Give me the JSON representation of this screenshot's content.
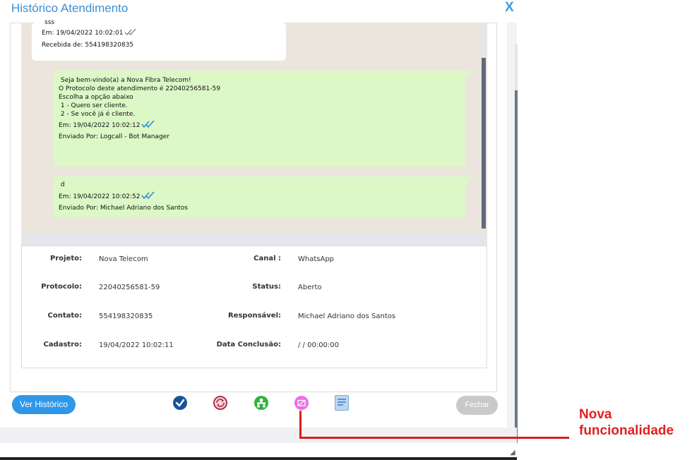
{
  "window": {
    "title": "Histórico Atendimento",
    "close_label": "X"
  },
  "messages": [
    {
      "text_lines": [
        "sss"
      ],
      "meta": "Em: 19/04/2022 10:02:01",
      "by": "Recebida de: 554198320835"
    },
    {
      "text_lines": [
        " Seja bem-vindo(a) a Nova Fibra Telecom!",
        "O Protocolo deste atendimento é 22040256581-59",
        "",
        "Escolha a opção abaixo",
        "",
        " 1 - Quero ser cliente.",
        " 2 - Se você já é cliente."
      ],
      "meta": "Em: 19/04/2022 10:02:12",
      "by": "Enviado Por: Logcall - Bot Manager"
    },
    {
      "text_lines": [
        " d"
      ],
      "meta": "Em: 19/04/2022 10:02:52",
      "by": "Enviado Por: Michael Adriano dos Santos"
    }
  ],
  "info": {
    "projeto_label": "Projeto:",
    "projeto": "Nova Telecom",
    "canal_label": "Canal :",
    "canal": "WhatsApp",
    "protocolo_label": "Protocolo:",
    "protocolo": "22040256581-59",
    "status_label": "Status:",
    "status": "Aberto",
    "contato_label": "Contato:",
    "contato": "554198320835",
    "responsavel_label": "Responsável:",
    "responsavel": "Michael Adriano dos Santos",
    "cadastro_label": "Cadastro:",
    "cadastro": "19/04/2022 10:02:11",
    "conclusao_label": "Data Conclusão:",
    "conclusao": "/ / 00:00:00"
  },
  "buttons": {
    "ver_historico": "Ver Histórico",
    "fechar": "Fechar"
  },
  "toolbar_icons": [
    "check-icon",
    "refresh-icon",
    "users-icon",
    "mail-icon",
    "document-icon"
  ],
  "annotation": {
    "line1": "Nova",
    "line2": "funcionalidade"
  },
  "colors": {
    "accent": "#2f97e8",
    "bubble_out": "#dcf8c6",
    "chat_bg": "#ece5dd",
    "annotation": "#e3201f"
  }
}
